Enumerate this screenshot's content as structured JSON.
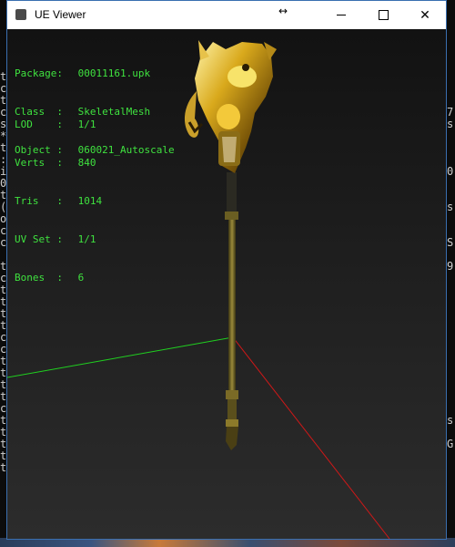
{
  "window": {
    "title": "UE Viewer"
  },
  "object_info": {
    "package": {
      "label": "Package:",
      "value": "00011161.upk"
    },
    "class": {
      "label": "Class  :",
      "value": "SkeletalMesh"
    },
    "object": {
      "label": "Object :",
      "value": "060021_Autoscale"
    }
  },
  "mesh_stats": {
    "lod": {
      "label": "LOD    :",
      "value": "1/1"
    },
    "verts": {
      "label": "Verts  :",
      "value": "840"
    },
    "tris": {
      "label": "Tris   :",
      "value": "1014"
    },
    "uv_set": {
      "label": "UV Set :",
      "value": "1/1"
    },
    "bones": {
      "label": "Bones  :",
      "value": "6"
    }
  },
  "background_console": {
    "left_chars": [
      "",
      "",
      "",
      "",
      "",
      "",
      "t",
      "c",
      "t",
      "c",
      "s",
      "*",
      "t",
      ":",
      "i",
      "0",
      "t",
      "(",
      "o",
      "c",
      "c",
      "",
      "t",
      "c",
      "t",
      "t",
      "t",
      "t",
      "c",
      "c",
      "t",
      "t",
      "t",
      "t",
      "c",
      "t",
      "t",
      "t",
      "t",
      "t"
    ],
    "right_chars": [
      "",
      "",
      "",
      "",
      "",
      "",
      "",
      "",
      "",
      "7",
      "s",
      "",
      "",
      "",
      "0",
      "",
      "",
      "s",
      "",
      "",
      "S",
      "",
      "9",
      "",
      "",
      "",
      "",
      "",
      "",
      "",
      "",
      "",
      "",
      "",
      "",
      "s",
      "",
      "G",
      "",
      ""
    ]
  },
  "colors": {
    "info_text": "#3fe23f",
    "axis_x": "#d01818",
    "axis_y": "#20d020",
    "window_border": "#3a6fb0"
  }
}
